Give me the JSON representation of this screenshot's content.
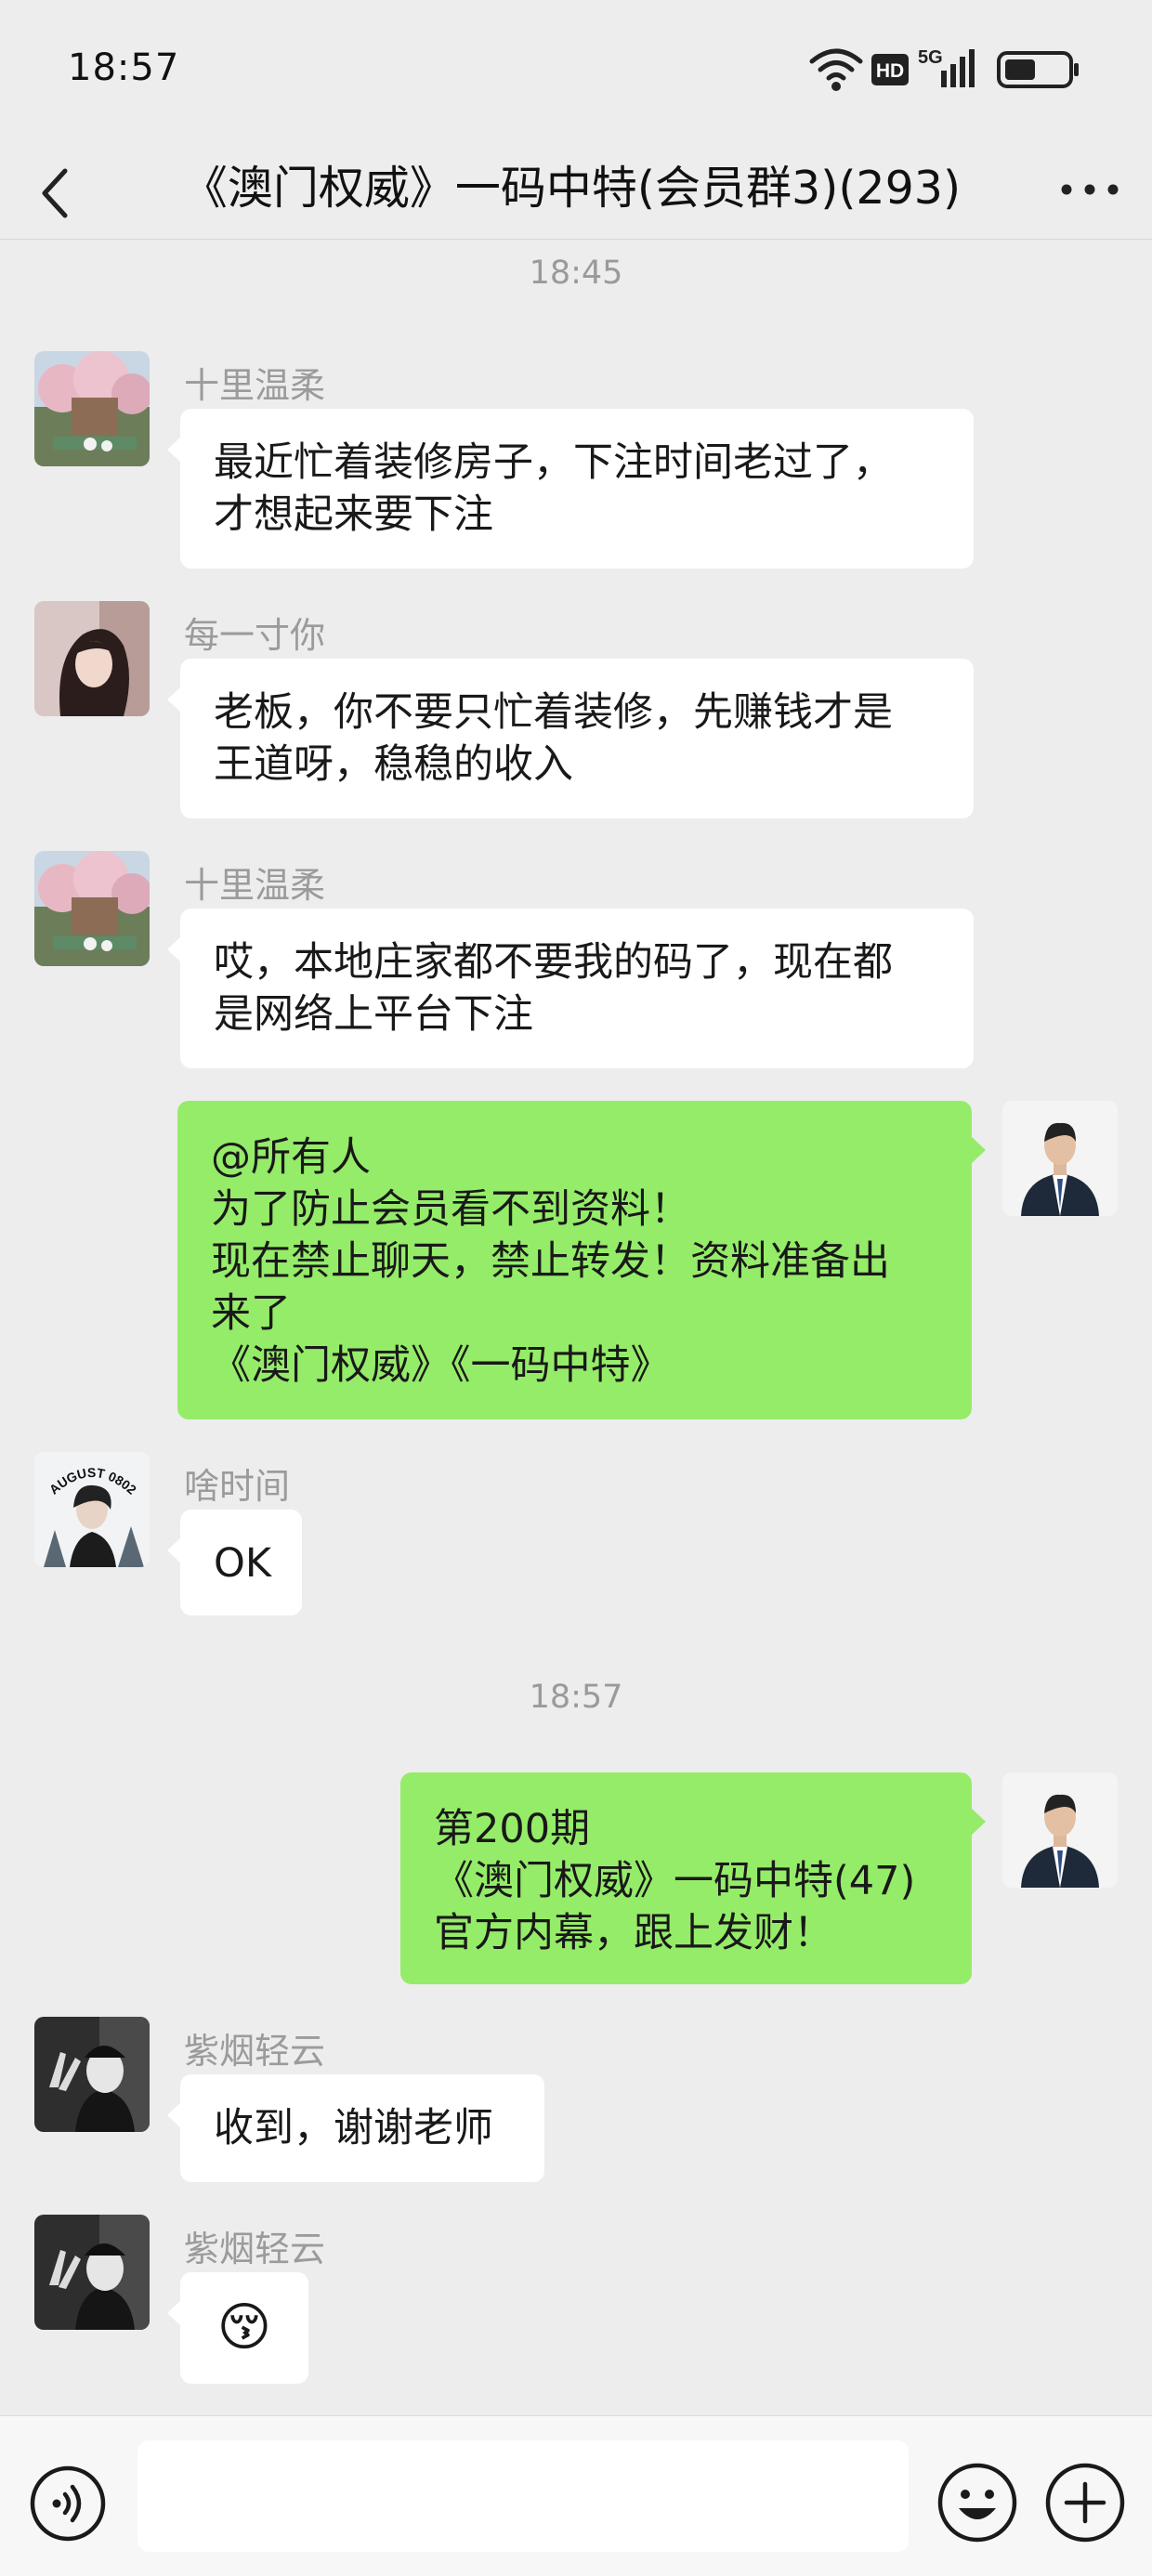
{
  "status_bar": {
    "time": "18:57",
    "network": "5G",
    "hd": "HD",
    "icons": [
      "wifi-icon",
      "hd-icon",
      "signal-5g-icon",
      "battery-icon"
    ]
  },
  "nav": {
    "title": "《澳门权威》一码中特(会员群3)(293)",
    "back_icon": "chevron-left-icon",
    "more_icon": "more-dots-icon"
  },
  "timestamps": [
    "18:45",
    "18:57"
  ],
  "messages": [
    {
      "nickname": "十里温柔",
      "lines": [
        "最近忙着装修房子，下注时间老过了，",
        "才想起来要下注"
      ]
    },
    {
      "nickname": "每一寸你",
      "lines": [
        "老板，你不要只忙着装修，先赚钱才是",
        "王道呀，稳稳的收入"
      ]
    },
    {
      "nickname": "十里温柔",
      "lines": [
        "哎，本地庄家都不要我的码了，现在都",
        "是网络上平台下注"
      ]
    },
    {
      "lines": [
        "@所有人",
        "为了防止会员看不到资料！",
        "现在禁止聊天，禁止转发！资料准备出",
        "来了",
        "《澳门权威》《一码中特》"
      ]
    },
    {
      "nickname": "啥时间",
      "lines": [
        "OK"
      ],
      "avatar_text": "AUGUST 0802"
    },
    {
      "lines": [
        "第200期",
        "《澳门权威》一码中特(47)",
        "官方内幕，跟上发财！"
      ]
    },
    {
      "nickname": "紫烟轻云",
      "lines": [
        "收到，谢谢老师"
      ]
    },
    {
      "nickname": "紫烟轻云",
      "emoji": "😚"
    }
  ],
  "input_bar": {
    "voice_icon": "voice-icon",
    "emoji_icon": "emoji-icon",
    "plus_icon": "plus-icon"
  },
  "colors": {
    "background": "#ededed",
    "self_bubble": "#95ec69",
    "other_bubble": "#ffffff",
    "nickname": "#9b9b9b"
  }
}
